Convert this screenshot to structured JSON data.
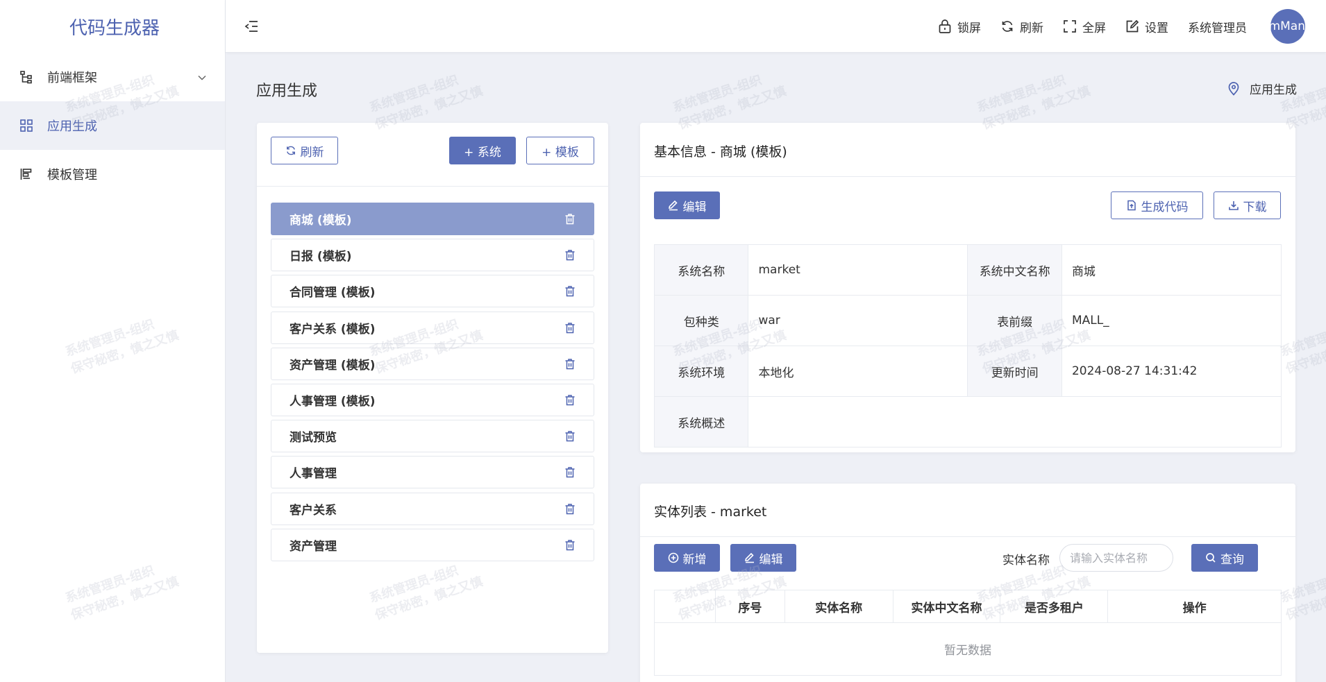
{
  "app": {
    "title": "代码生成器"
  },
  "sidebar": {
    "items": [
      {
        "label": "前端框架",
        "icon": "tree-structure-icon"
      },
      {
        "label": "应用生成",
        "icon": "grid-icon"
      },
      {
        "label": "模板管理",
        "icon": "template-layout-icon"
      }
    ]
  },
  "header": {
    "lock": "锁屏",
    "refresh": "刷新",
    "fullscreen": "全屏",
    "settings": "设置",
    "user": "系统管理员",
    "avatar_text": "mMan"
  },
  "page": {
    "title": "应用生成",
    "breadcrumb": "应用生成"
  },
  "left_panel": {
    "refresh_btn": "刷新",
    "add_system_btn": "+ 系统",
    "add_template_btn": "+ 模板",
    "apps": [
      "商城 (模板)",
      "日报 (模板)",
      "合同管理 (模板)",
      "客户关系 (模板)",
      "资产管理 (模板)",
      "人事管理 (模板)",
      "测试预览",
      "人事管理",
      "客户关系",
      "资产管理"
    ],
    "selected_index": 0
  },
  "basic_info": {
    "title": "基本信息 - 商城 (模板)",
    "edit_btn": "编辑",
    "generate_btn": "生成代码",
    "download_btn": "下载",
    "rows": [
      {
        "l1": "系统名称",
        "v1": "market",
        "l2": "系统中文名称",
        "v2": "商城"
      },
      {
        "l1": "包种类",
        "v1": "war",
        "l2": "表前缀",
        "v2": "MALL_"
      },
      {
        "l1": "系统环境",
        "v1": "本地化",
        "l2": "更新时间",
        "v2": "2024-08-27 14:31:42"
      }
    ],
    "summary_label": "系统概述",
    "summary_value": ""
  },
  "entity_list": {
    "title": "实体列表 - market",
    "add_btn": "新增",
    "edit_btn": "编辑",
    "search_label": "实体名称",
    "search_placeholder": "请输入实体名称",
    "query_btn": "查询",
    "columns": [
      "",
      "序号",
      "实体名称",
      "实体中文名称",
      "是否多租户",
      "操作"
    ],
    "empty_text": "暂无数据"
  },
  "watermark": {
    "line1": "系统管理员-组织",
    "line2": "保守秘密，慎之又慎"
  },
  "colors": {
    "primary": "#5a6fb8",
    "selected_item": "#8a9bcd"
  }
}
